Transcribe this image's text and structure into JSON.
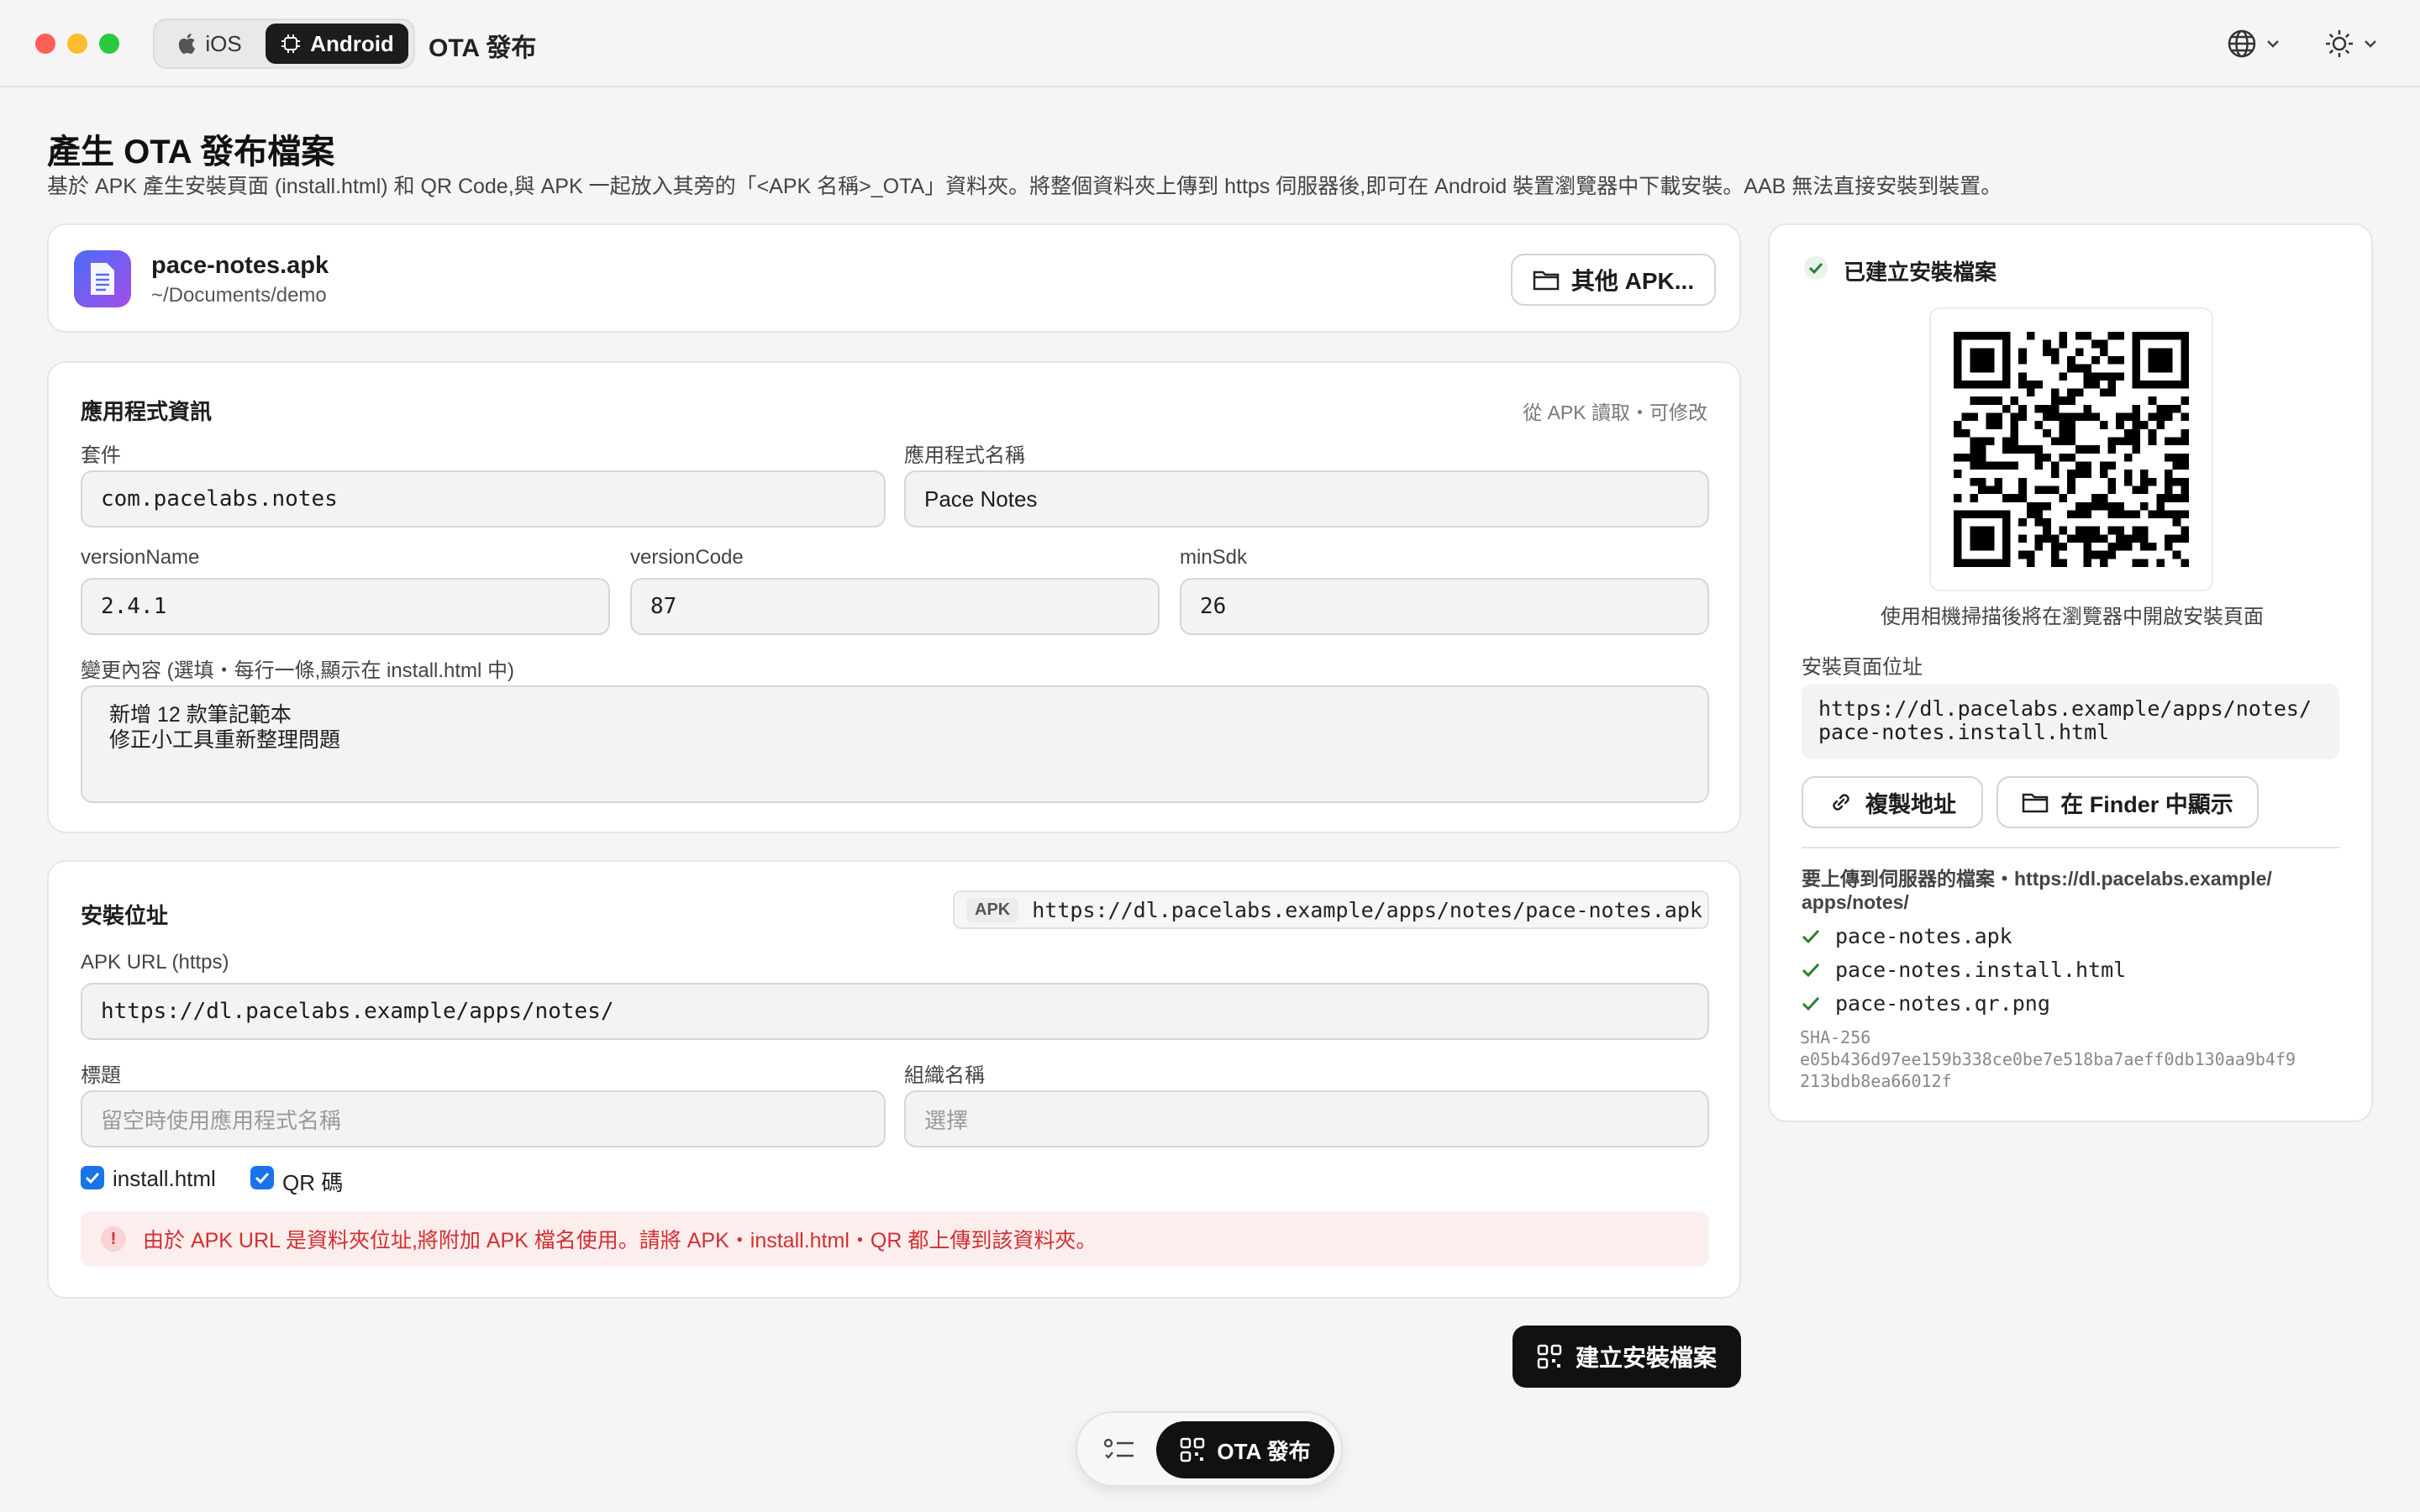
{
  "titlebar": {
    "platform_ios": "iOS",
    "platform_android": "Android",
    "app_title": "OTA 發布",
    "language_icon": "globe-icon",
    "theme_icon": "sun-icon"
  },
  "header": {
    "title": "產生 OTA 發布檔案",
    "description": "基於 APK 產生安裝頁面 (install.html) 和 QR Code,與 APK 一起放入其旁的「<APK 名稱>_OTA」資料夾。將整個資料夾上傳到 https 伺服器後,即可在 Android 裝置瀏覽器中下載安裝。AAB 無法直接安裝到裝置。"
  },
  "file_card": {
    "file_name": "pace-notes.apk",
    "file_path": "~/Documents/demo",
    "other_button": "其他 APK..."
  },
  "app_info": {
    "title": "應用程式資訊",
    "hint": "從 APK 讀取・可修改",
    "package_label": "套件",
    "package_value": "com.pacelabs.notes",
    "name_label": "應用程式名稱",
    "name_value": "Pace Notes",
    "version_name_label": "versionName",
    "version_name_value": "2.4.1",
    "version_code_label": "versionCode",
    "version_code_value": "87",
    "min_sdk_label": "minSdk",
    "min_sdk_value": "26",
    "changes_label": "變更內容 (選填・每行一條,顯示在 install.html 中)",
    "changes_line1": "新增 12 款筆記範本",
    "changes_line2": "修正小工具重新整理問題"
  },
  "install": {
    "title": "安裝位址",
    "badge": "APK",
    "resolved_url": "https://dl.pacelabs.example/apps/notes/pace-notes.apk",
    "apk_url_label": "APK URL (https)",
    "apk_url_value": "https://dl.pacelabs.example/apps/notes/",
    "title_label": "標題",
    "title_placeholder": "留空時使用應用程式名稱",
    "org_label": "組織名稱",
    "org_placeholder": "選擇",
    "opt_install": "install.html",
    "opt_qr": "QR 碼",
    "warning": "由於 APK URL 是資料夾位址,將附加 APK 檔名使用。請將 APK・install.html・QR 都上傳到該資料夾。"
  },
  "actions": {
    "build_button": "建立安裝檔案"
  },
  "result": {
    "title": "已建立安裝檔案",
    "qr_caption": "使用相機掃描後將在瀏覽器中開啟安裝頁面",
    "page_url_label": "安裝頁面位址",
    "page_url_line1": "https://dl.pacelabs.example/apps/notes/",
    "page_url_line2": "pace-notes.install.html",
    "copy_button": "複製地址",
    "finder_button": "在 Finder 中顯示",
    "upload_label_line1": "要上傳到伺服器的檔案・https://dl.pacelabs.example/",
    "upload_label_line2": "apps/notes/",
    "files": [
      "pace-notes.apk",
      "pace-notes.install.html",
      "pace-notes.qr.png"
    ],
    "sha_label": "SHA-256",
    "sha_line1": "e05b436d97ee159b338ce0be7e518ba7aeff0db130aa9b4f9",
    "sha_line2": "213bdb8ea66012f"
  },
  "bottom_nav": {
    "list_icon": "checklist-icon",
    "ota_label": "OTA 發布"
  },
  "colors": {
    "accent": "#1a73e8",
    "dark_button": "#111111",
    "success": "#2e7d32",
    "warning_text": "#d32f2f",
    "warning_bg": "#fdeeee"
  }
}
